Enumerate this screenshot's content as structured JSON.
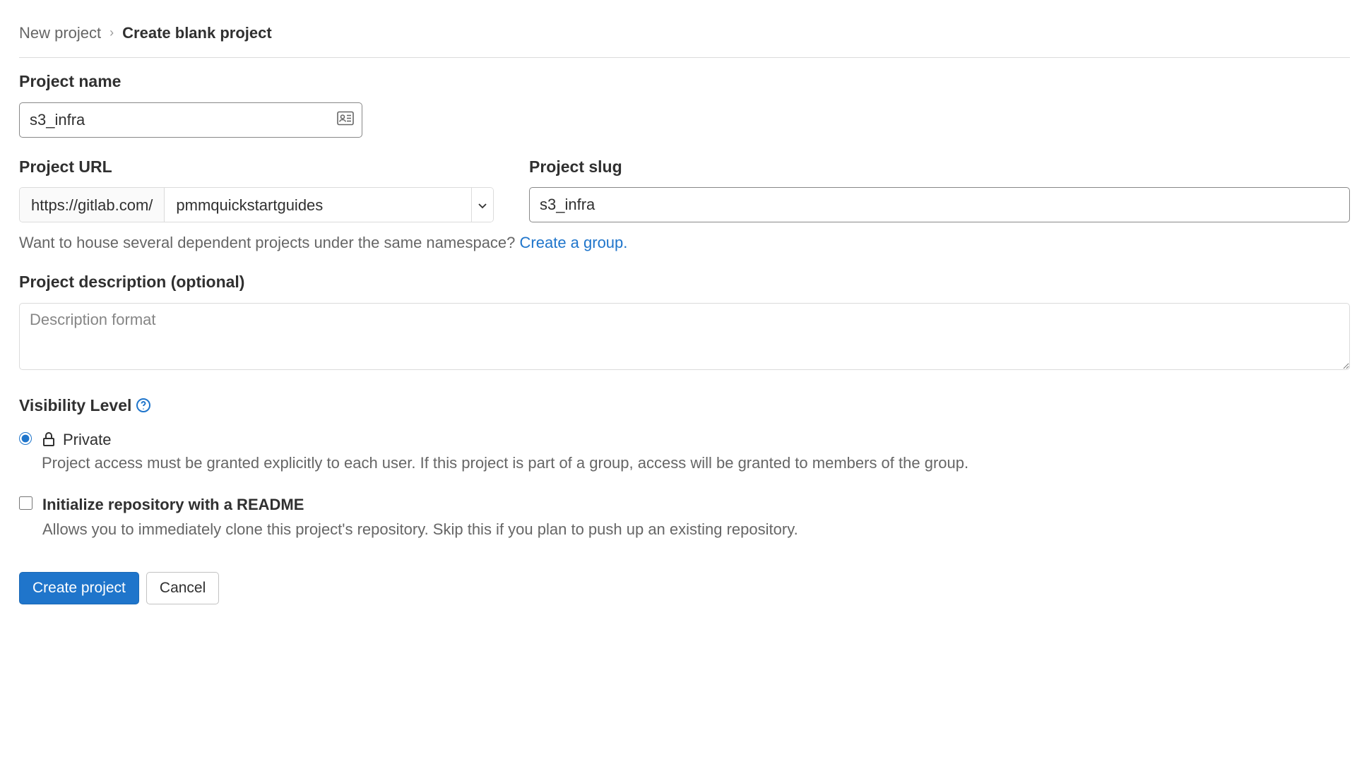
{
  "breadcrumb": {
    "parent": "New project",
    "current": "Create blank project"
  },
  "project_name": {
    "label": "Project name",
    "value": "s3_infra"
  },
  "project_url": {
    "label": "Project URL",
    "prefix": "https://gitlab.com/",
    "namespace": "pmmquickstartguides"
  },
  "project_slug": {
    "label": "Project slug",
    "value": "s3_infra"
  },
  "namespace_helper": {
    "text": "Want to house several dependent projects under the same namespace? ",
    "link_text": "Create a group."
  },
  "description": {
    "label": "Project description (optional)",
    "placeholder": "Description format"
  },
  "visibility": {
    "label": "Visibility Level",
    "option_title": "Private",
    "option_desc": "Project access must be granted explicitly to each user. If this project is part of a group, access will be granted to members of the group."
  },
  "readme": {
    "title": "Initialize repository with a README",
    "desc": "Allows you to immediately clone this project's repository. Skip this if you plan to push up an existing repository."
  },
  "buttons": {
    "create": "Create project",
    "cancel": "Cancel"
  }
}
